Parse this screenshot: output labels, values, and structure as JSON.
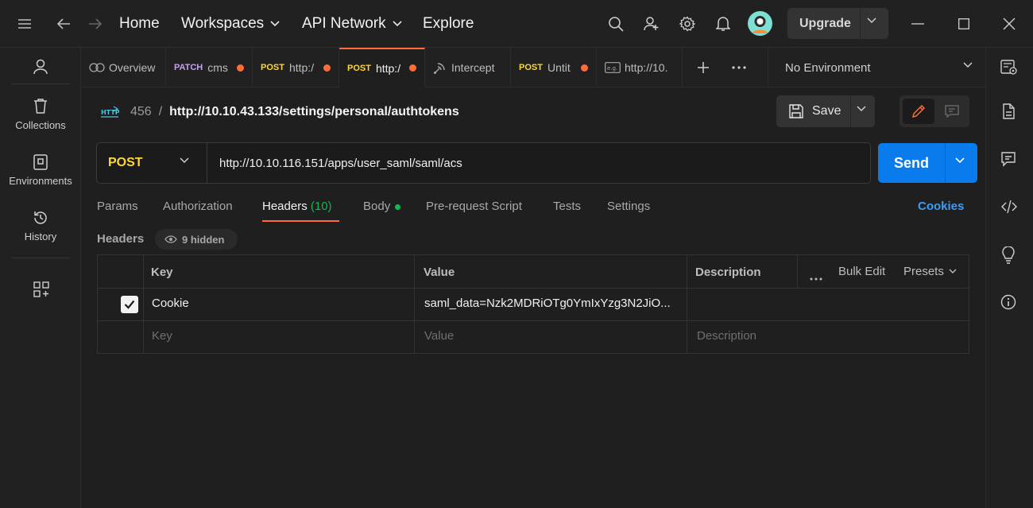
{
  "topbar": {
    "nav": {
      "home": "Home",
      "workspaces": "Workspaces",
      "api_network": "API Network",
      "explore": "Explore"
    },
    "upgrade": "Upgrade"
  },
  "sidebar": {
    "items": [
      {
        "label": "Collections",
        "icon": "trash-can-icon"
      },
      {
        "label": "Environments",
        "icon": "environment-icon"
      },
      {
        "label": "History",
        "icon": "history-icon"
      }
    ]
  },
  "tabs": [
    {
      "method": "",
      "label": "Overview",
      "icon": "overview-icon",
      "unsaved": false
    },
    {
      "method": "PATCH",
      "label": "cms",
      "unsaved": true
    },
    {
      "method": "POST",
      "label": "http:/",
      "unsaved": true
    },
    {
      "method": "POST",
      "label": "http:/",
      "unsaved": true,
      "active": true
    },
    {
      "method": "",
      "label": "Intercept",
      "icon": "intercept-icon",
      "unsaved": false
    },
    {
      "method": "POST",
      "label": "Untit",
      "unsaved": true
    },
    {
      "method": "",
      "label": "http://10.",
      "icon": "example-icon",
      "unsaved": false
    }
  ],
  "environment": {
    "selected": "No Environment"
  },
  "request": {
    "breadcrumb": {
      "collection": "456",
      "sep": "/",
      "path": "http://10.10.43.133/settings/personal/authtokens"
    },
    "save": "Save",
    "method": "POST",
    "url": "http://10.10.116.151/apps/user_saml/saml/acs",
    "send": "Send"
  },
  "request_tabs": {
    "params": "Params",
    "authorization": "Authorization",
    "headers": "Headers",
    "headers_count": "(10)",
    "body": "Body",
    "prerequest": "Pre-request Script",
    "tests": "Tests",
    "settings": "Settings",
    "cookies": "Cookies"
  },
  "headers_section": {
    "title": "Headers",
    "hidden": "9 hidden",
    "columns": {
      "key": "Key",
      "value": "Value",
      "description": "Description"
    },
    "bulk_edit": "Bulk Edit",
    "presets": "Presets",
    "rows": [
      {
        "checked": true,
        "key": "Cookie",
        "value": "saml_data=Nzk2MDRiOTg0YmIxYzg3N2JiO...",
        "description": ""
      }
    ],
    "placeholders": {
      "key": "Key",
      "value": "Value",
      "description": "Description"
    }
  },
  "colors": {
    "accent": "#ff6c37",
    "send": "#097bed",
    "post": "#ffd633",
    "patch": "#c7a0f2",
    "success": "#0cbb52",
    "link": "#3d9df5"
  }
}
